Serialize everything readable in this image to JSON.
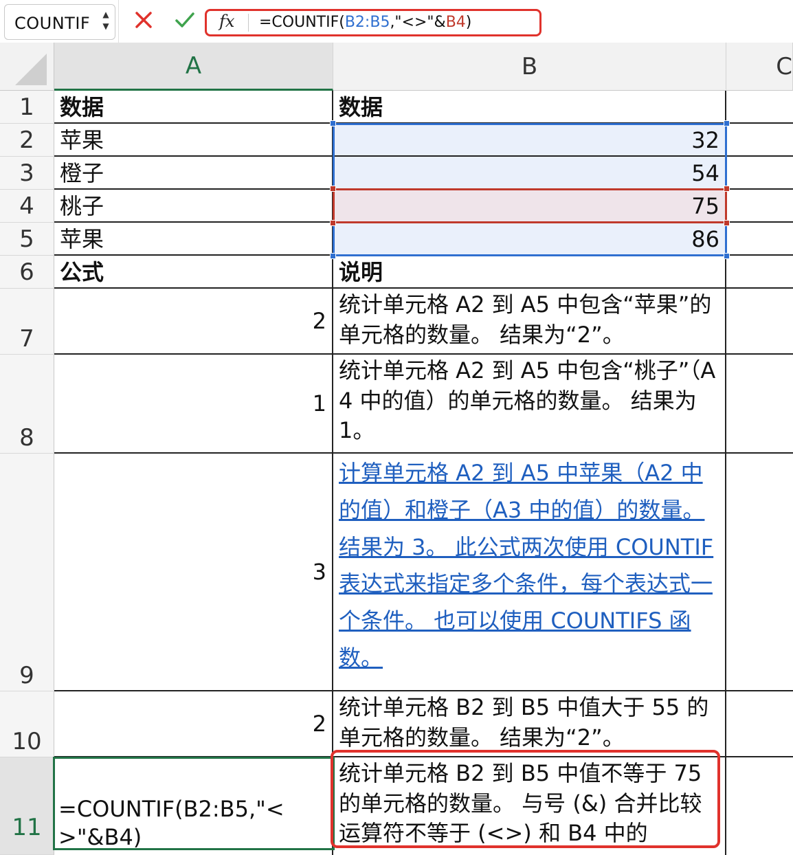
{
  "formula_bar": {
    "name_box": "COUNTIF",
    "formula_prefix": "=COUNTIF(",
    "formula_ref1": "B2:B5",
    "formula_mid": ",\"<>\"&",
    "formula_ref2": "B4",
    "formula_suffix": ")",
    "fx_label": "fx"
  },
  "columns": [
    {
      "label": "A"
    },
    {
      "label": "B"
    },
    {
      "label": "C"
    }
  ],
  "rows": [
    {
      "num": "1",
      "a": "数据",
      "b": "数据"
    },
    {
      "num": "2",
      "a": "苹果",
      "b": "32"
    },
    {
      "num": "3",
      "a": "橙子",
      "b": "54"
    },
    {
      "num": "4",
      "a": "桃子",
      "b": "75"
    },
    {
      "num": "5",
      "a": "苹果",
      "b": "86"
    },
    {
      "num": "6",
      "a": "公式",
      "b": "说明"
    },
    {
      "num": "7",
      "a": "2",
      "b": "统计单元格 A2 到 A5 中包含“苹果”的单元格的数量。 结果为“2”。"
    },
    {
      "num": "8",
      "a": "1",
      "b": "统计单元格 A2 到 A5 中包含“桃子”（A4 中的值）的单元格的数量。 结果为 1。"
    },
    {
      "num": "9",
      "a": "3",
      "b": "计算单元格 A2 到 A5 中苹果（A2 中的值）和橙子（A3 中的值）的数量。 结果为 3。 此公式两次使用 COUNTIF 表达式来指定多个条件，每个表达式一个条件。 也可以使用 COUNTIFS 函数。"
    },
    {
      "num": "10",
      "a": "2",
      "b": "统计单元格 B2 到 B5 中值大于 55 的单元格的数量。 结果为“2”。"
    },
    {
      "num": "11",
      "a": "=COUNTIF(B2:B5,\"<>\"&B4)",
      "b": "统计单元格 B2 到 B5 中值不等于 75 的单元格的数量。 与号 (&) 合并比较运算符不等于 (<>) 和 B4 中的"
    }
  ],
  "colors": {
    "accent_green": "#217346",
    "ref_blue": "#2f6fd0",
    "ref_red": "#c0392b",
    "callout_red": "#e0322c",
    "link_blue": "#1f5fbf"
  }
}
